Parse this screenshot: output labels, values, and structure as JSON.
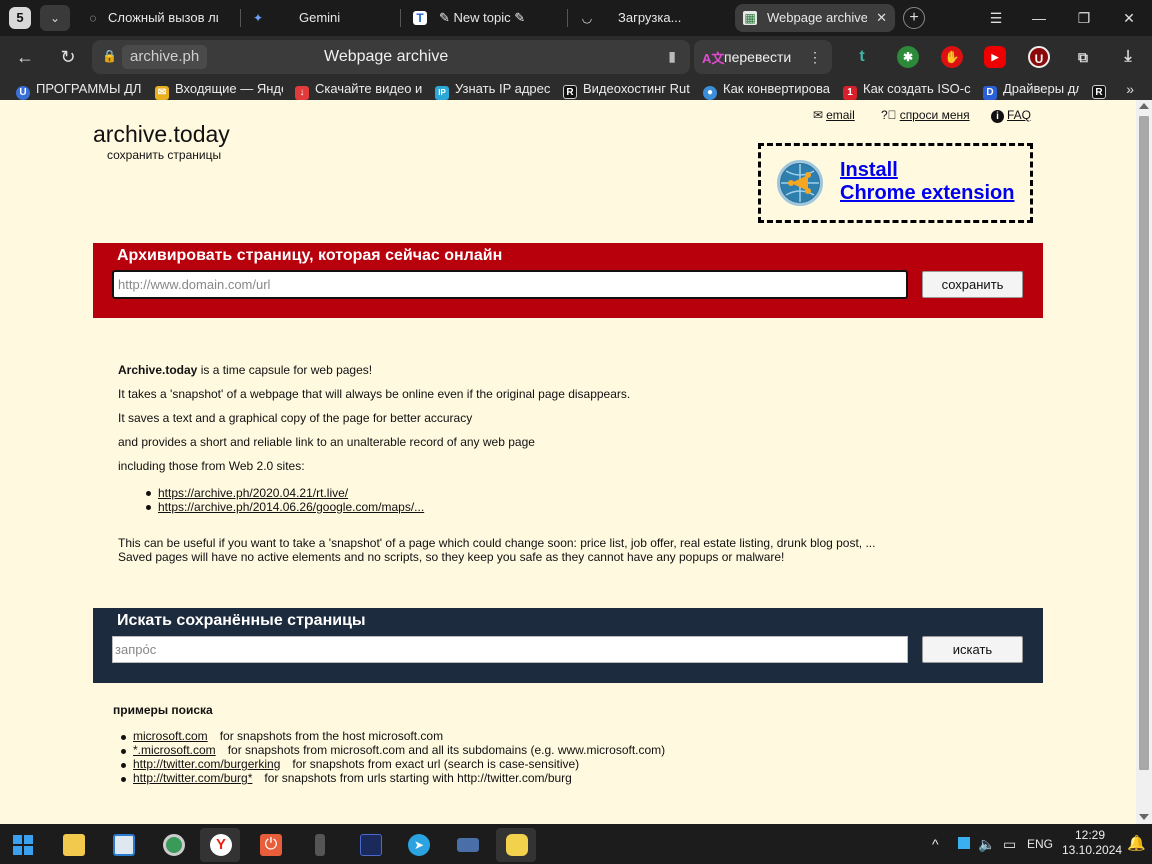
{
  "browser": {
    "tab_count": "5",
    "tabs": [
      {
        "title": "Сложный вызов ли",
        "favicon": "spinner-icon"
      },
      {
        "title": "Gemini",
        "favicon": "gemini-icon"
      },
      {
        "title": "New topic",
        "favicon": "t-logo-icon"
      },
      {
        "title": "Загрузка...",
        "favicon": "spinner-icon"
      },
      {
        "title": "Webpage archive",
        "favicon": "archive-icon"
      }
    ],
    "address": {
      "domain": "archive.ph",
      "page_title": "Webpage archive"
    },
    "translate_label": "перевести",
    "bookmarks": [
      {
        "label": "ПРОГРАММЫ ДЛ",
        "color": "#3a6fd8",
        "glyph": "U"
      },
      {
        "label": "Входящие — Янде",
        "color": "#e8b020",
        "glyph": "✉"
      },
      {
        "label": "Скачайте видео и",
        "color": "#e03a3a",
        "glyph": "↓"
      },
      {
        "label": "Узнать IP адрес",
        "color": "#2aa9d8",
        "glyph": "IP"
      },
      {
        "label": "Видеохостинг Rut",
        "color": "#111111",
        "glyph": "R"
      },
      {
        "label": "Как конвертирова",
        "color": "#3a8fd8",
        "glyph": "●"
      },
      {
        "label": "Как создать ISO-с",
        "color": "#d8202a",
        "glyph": "1"
      },
      {
        "label": "Драйверы дл",
        "color": "#2a5fd8",
        "glyph": "D"
      }
    ]
  },
  "page": {
    "logo": {
      "title": "archive.today",
      "subtitle": "сохранить страницы"
    },
    "top_links": {
      "email": "email",
      "ask": "спроси меня",
      "faq": "FAQ"
    },
    "install": {
      "line1": "Install",
      "line2": "Chrome extension"
    },
    "archive_form": {
      "heading": "Архивировать страницу, которая сейчас онлайн",
      "placeholder": "http://www.domain.com/url",
      "button": "сохранить"
    },
    "about": {
      "intro_bold": "Archive.today",
      "intro_rest": " is a time capsule for web pages!",
      "lines": [
        "It takes a 'snapshot' of a webpage that will always be online even if the original page disappears.",
        "It saves a text and a graphical copy of the page for better accuracy",
        "and provides a short and reliable link to an unalterable record of any web page",
        "including those from Web 2.0 sites:"
      ],
      "links": [
        "https://archive.ph/2020.04.21/rt.live/",
        "https://archive.ph/2014.06.26/google.com/maps/..."
      ],
      "footer_lines": [
        "This can be useful if you want to take a 'snapshot' of a page which could change soon: price list, job offer, real estate listing, drunk blog post, ...",
        "Saved pages will have no active elements and no scripts, so they keep you safe as they cannot have any popups or malware!"
      ]
    },
    "search_form": {
      "heading": "Искать сохранённые страницы",
      "placeholder": "запро́с",
      "button": "искать"
    },
    "examples": {
      "heading": "примеры поиска",
      "items": [
        {
          "query": "microsoft.com",
          "desc": "for snapshots from the host microsoft.com"
        },
        {
          "query": "*.microsoft.com",
          "desc": "for snapshots from microsoft.com and all its subdomains (e.g. www.microsoft.com)"
        },
        {
          "query": "http://twitter.com/burgerking",
          "desc": "for snapshots from exact url (search is case-sensitive)"
        },
        {
          "query": "http://twitter.com/burg*",
          "desc": "for snapshots from urls starting with http://twitter.com/burg"
        }
      ]
    }
  },
  "taskbar": {
    "language": "ENG",
    "time": "12:29",
    "date": "13.10.2024"
  },
  "colors": {
    "page_bg": "#fff9e0",
    "archive_panel": "#b8000d",
    "search_panel": "#1c2b3e",
    "link_blue": "#0000ee"
  }
}
